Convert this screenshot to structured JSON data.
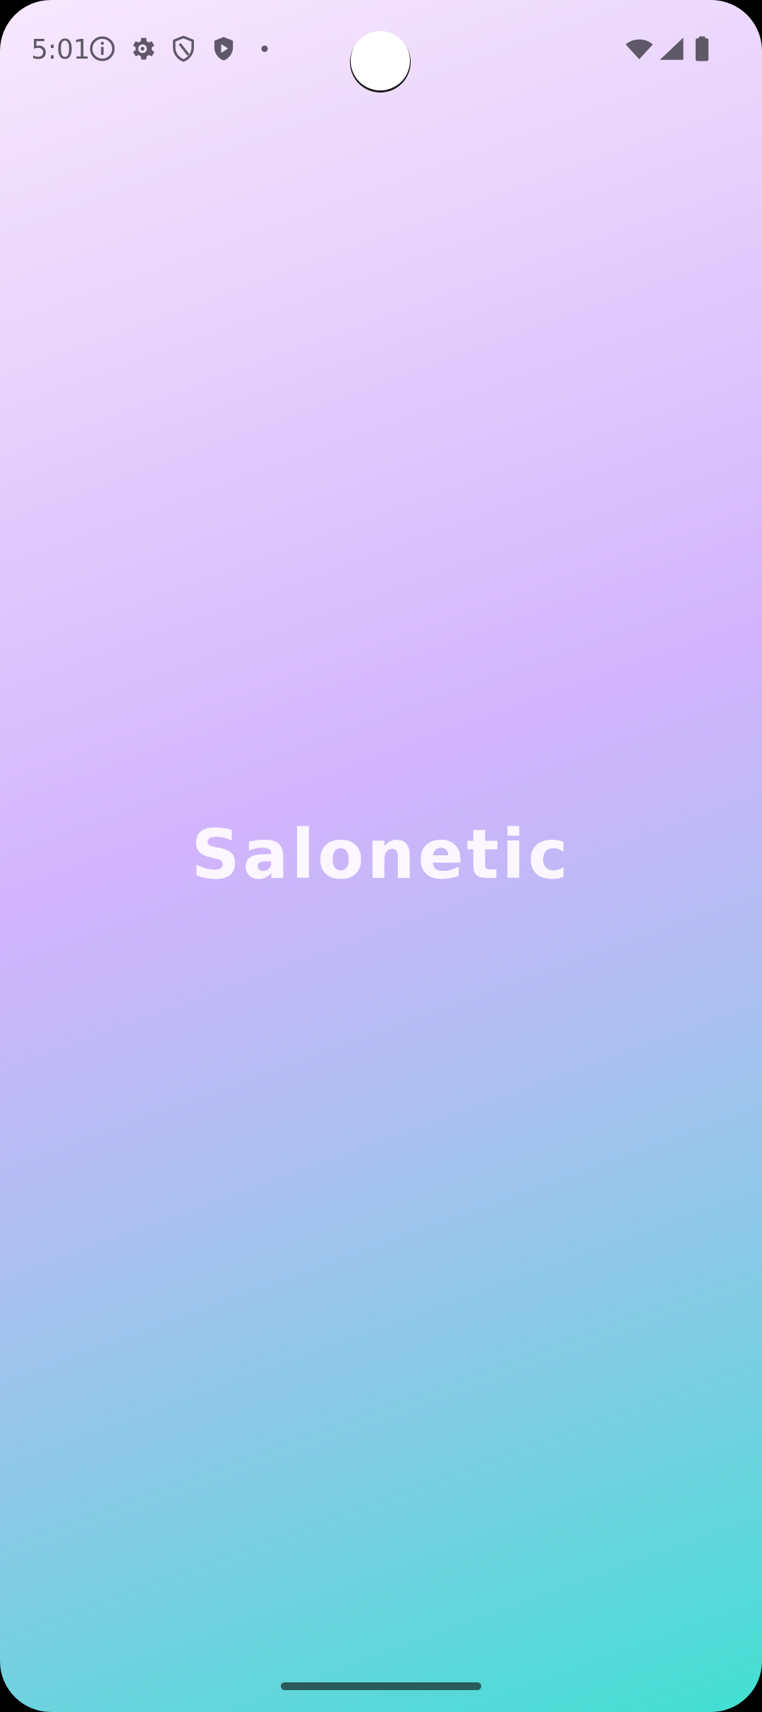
{
  "status_bar": {
    "time": "5:01",
    "left_icons": [
      "info-icon",
      "gear-icon",
      "shield-outline-icon",
      "play-shield-icon",
      "dot-icon"
    ],
    "right_icons": [
      "wifi-icon",
      "signal-icon",
      "battery-icon"
    ],
    "icon_color": "#5f5868"
  },
  "splash": {
    "app_name": "Salonetic",
    "gradient_colors": [
      "#f8e8fd",
      "#d2b4fd",
      "#42dfd2"
    ]
  },
  "navigation": {
    "home_indicator_color": "#2a5b5c"
  }
}
